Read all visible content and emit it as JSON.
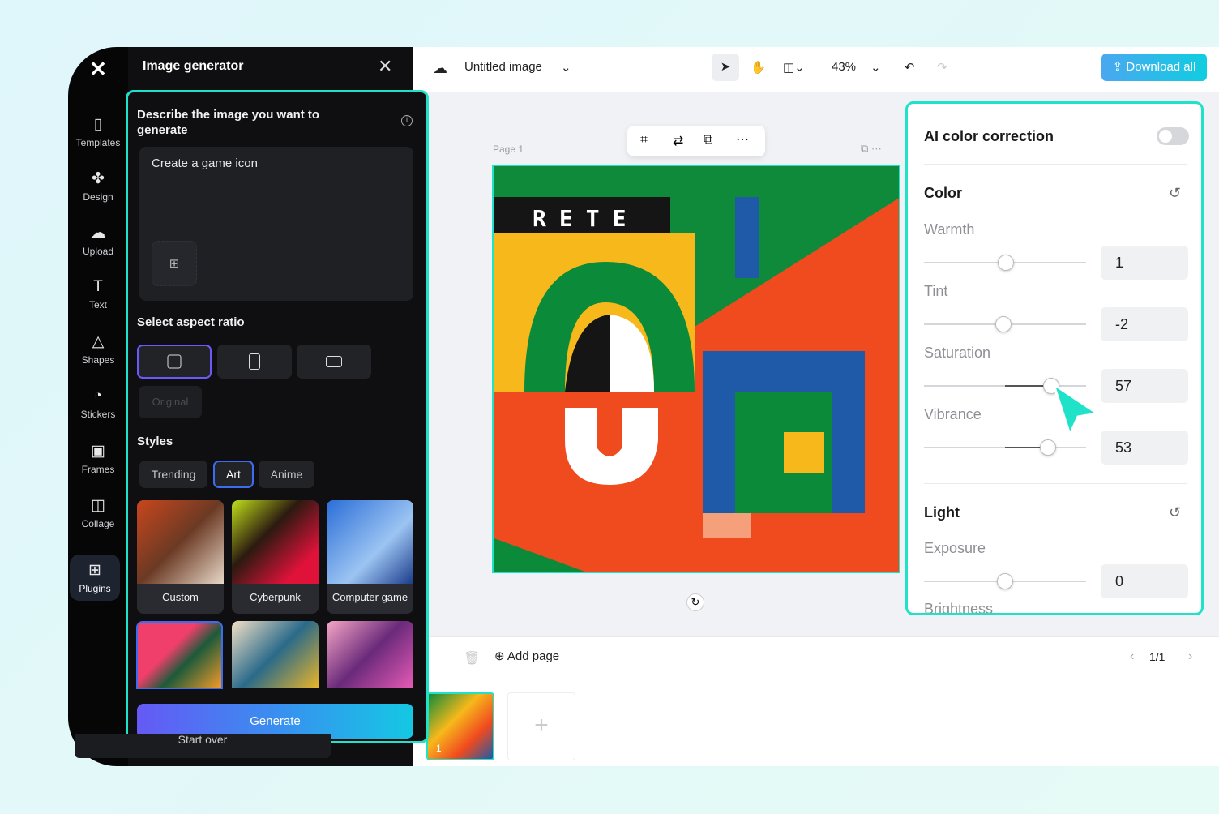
{
  "rail": {
    "items": [
      {
        "label": "Templates",
        "icon": "templates-icon"
      },
      {
        "label": "Design",
        "icon": "design-icon"
      },
      {
        "label": "Upload",
        "icon": "upload-icon"
      },
      {
        "label": "Text",
        "icon": "text-icon"
      },
      {
        "label": "Shapes",
        "icon": "shapes-icon"
      },
      {
        "label": "Stickers",
        "icon": "stickers-icon"
      },
      {
        "label": "Frames",
        "icon": "frames-icon"
      },
      {
        "label": "Collage",
        "icon": "collage-icon"
      },
      {
        "label": "Plugins",
        "icon": "plugins-icon"
      }
    ],
    "active": "Plugins"
  },
  "panel": {
    "title": "Image generator",
    "describe_label": "Describe the image you want to generate",
    "prompt_value": "Create a game icon",
    "aspect_label": "Select aspect ratio",
    "original_label": "Original",
    "styles_label": "Styles",
    "style_tabs": [
      "Trending",
      "Art",
      "Anime"
    ],
    "selected_tab": "Art",
    "styles": [
      "Custom",
      "Cyberpunk",
      "Computer game"
    ],
    "generate_label": "Generate",
    "start_over_label": "Start over"
  },
  "topbar": {
    "title": "Untitled image",
    "zoom": "43%",
    "download_label": "Download all"
  },
  "canvas": {
    "page_label": "Page 1",
    "art_text": "RETE"
  },
  "adjust": {
    "ai_label": "AI color correction",
    "ai_on": false,
    "color_section": "Color",
    "light_section": "Light",
    "sliders": [
      {
        "label": "Warmth",
        "value": "1"
      },
      {
        "label": "Tint",
        "value": "-2"
      },
      {
        "label": "Saturation",
        "value": "57"
      },
      {
        "label": "Vibrance",
        "value": "53"
      },
      {
        "label": "Exposure",
        "value": "0"
      },
      {
        "label": "Brightness",
        "value": ""
      }
    ]
  },
  "pages": {
    "add_page": "Add page",
    "counter": "1/1",
    "thumb_number": "1"
  },
  "colors": {
    "accent": "#1fe2c8",
    "primary": "#6559f5",
    "download": "#10cde0"
  }
}
